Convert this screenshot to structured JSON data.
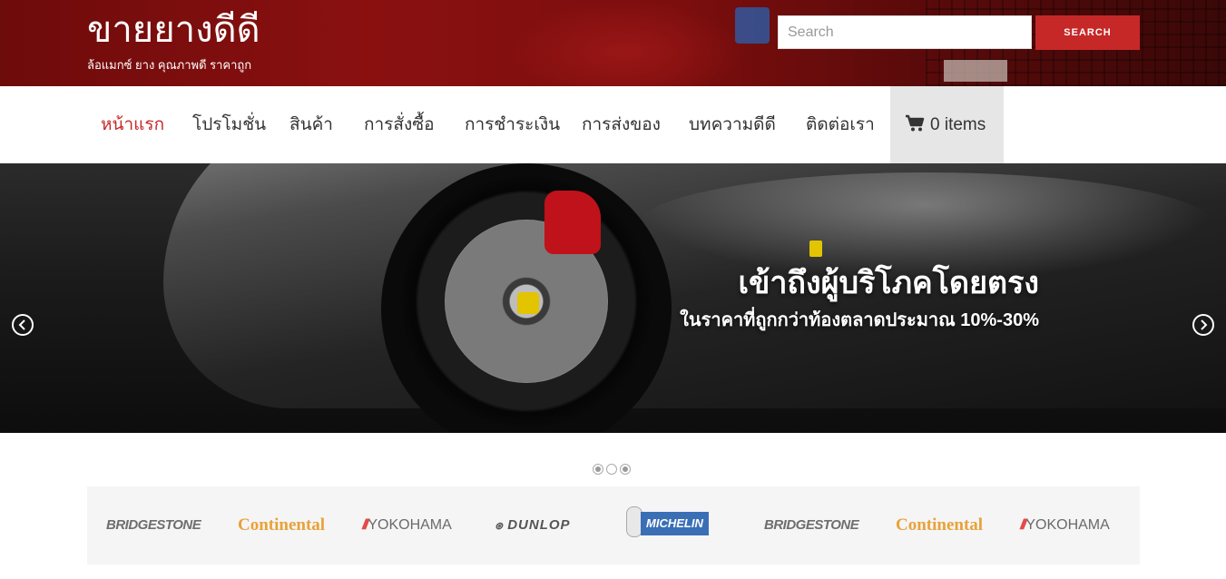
{
  "header": {
    "site_title": "ขายยางดีดี",
    "tagline": "ล้อแมกซ์ ยาง คุณภาพดี ราคาถูก",
    "search": {
      "placeholder": "Search",
      "value": "",
      "button_label": "SEARCH"
    }
  },
  "nav": {
    "items": [
      {
        "label": "หน้าแรก",
        "active": true
      },
      {
        "label": "โปรโมชั่น"
      },
      {
        "label": "สินค้า"
      },
      {
        "label": "การสั่งซื้อ"
      },
      {
        "label": "การชำระเงิน"
      },
      {
        "label": "การส่งของ"
      },
      {
        "label": "บทความดีดี"
      },
      {
        "label": "ติดต่อเรา"
      }
    ],
    "cart": {
      "label": "0 items",
      "icon": "cart-icon"
    }
  },
  "hero": {
    "title": "เข้าถึงผู้บริโภคโดยตรง",
    "subtitle": "ในราคาที่ถูกกว่าท้องตลาดประมาณ 10%-30%",
    "prev_icon": "chevron-left-icon",
    "next_icon": "chevron-right-icon",
    "slides_total": 3,
    "active_slide": 2
  },
  "brands": {
    "items": [
      {
        "name": "BRIDGESTONE"
      },
      {
        "name": "Continental"
      },
      {
        "name": "YOKOHAMA"
      },
      {
        "name": "DUNLOP"
      },
      {
        "name": "MICHELIN"
      },
      {
        "name": "BRIDGESTONE"
      },
      {
        "name": "Continental"
      },
      {
        "name": "YOKOHAMA"
      }
    ]
  },
  "colors": {
    "accent": "#c62828",
    "header_bg": "#7d0e0e",
    "cart_bg": "#e6e6e6",
    "brand_strip_bg": "#f5f5f5"
  }
}
